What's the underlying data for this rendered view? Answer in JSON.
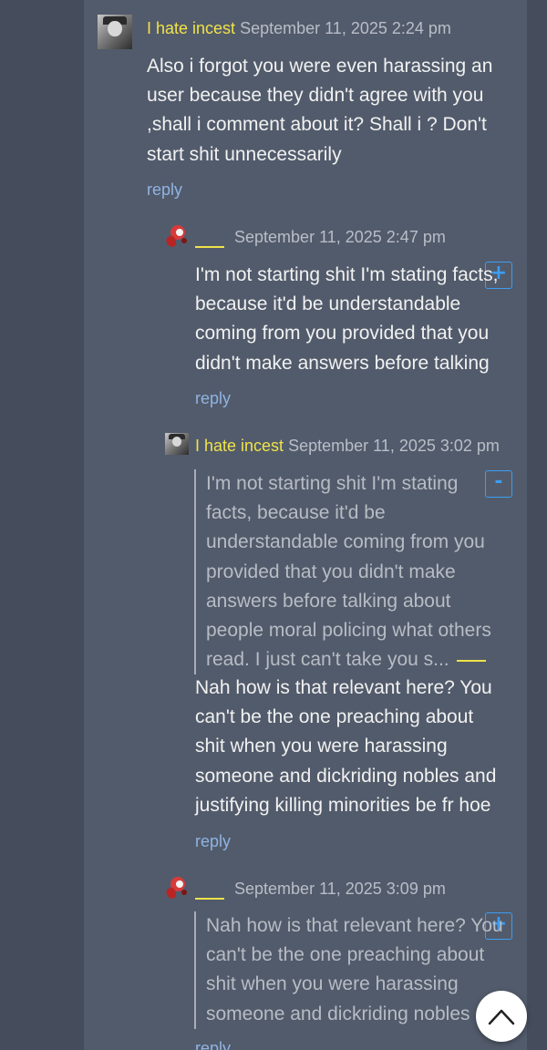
{
  "comments": [
    {
      "author": "I hate incest",
      "date": "September 11, 2025 2:24 pm",
      "body_lines": [
        "Also i forgot you were even harassing an",
        "user because they didn't agree with you",
        ",shall i comment about it? Shall i ? Don't",
        "start shit unnecessarily"
      ],
      "reply_label": "reply"
    },
    {
      "author": "____",
      "date": "September 11, 2025 2:47 pm",
      "toggle": "+",
      "body_lines": [
        "I'm not starting shit I'm stating facts,",
        "because it'd be understandable",
        "coming from you provided that you",
        "didn't make answers before talking"
      ],
      "reply_label": "reply"
    },
    {
      "author": "I hate incest",
      "date": "September 11, 2025 3:02 pm",
      "toggle": "-",
      "quote_lines": [
        "I'm not starting shit I'm stating",
        "facts, because it'd be",
        "understandable coming from you",
        "provided that you didn't make",
        "answers before talking about",
        "people moral policing what others",
        "read. I just can't take you s..."
      ],
      "body_lines": [
        "Nah how is that relevant here? You",
        "can't be the one preaching about",
        "shit when you were harassing",
        "someone and dickriding nobles and",
        "justifying killing minorities be fr hoe"
      ],
      "reply_label": "reply"
    },
    {
      "author": "____",
      "date": "September 11, 2025 3:09 pm",
      "toggle": "+",
      "quote_lines": [
        "Nah how is that relevant here? You",
        "can't be the one preaching about",
        "shit when you were harassing",
        "someone and dickriding nobles"
      ],
      "reply_label": "reply"
    }
  ],
  "scroll_top_icon": "chevron-up-icon"
}
